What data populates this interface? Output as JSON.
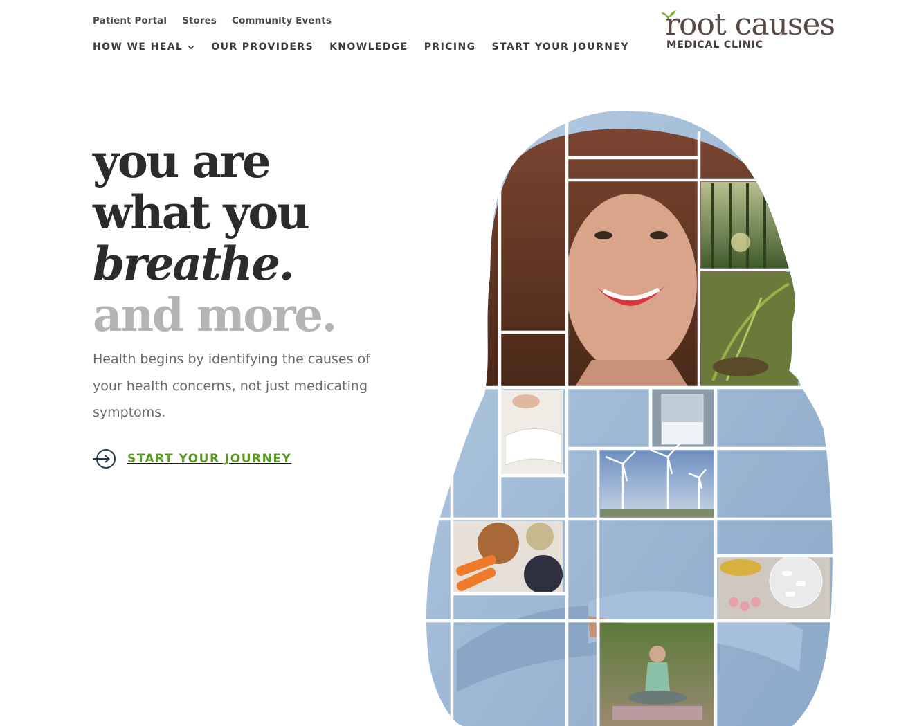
{
  "utility_nav": {
    "items": [
      "Patient Portal",
      "Stores",
      "Community Events"
    ]
  },
  "main_nav": {
    "items": [
      "HOW WE HEAL",
      "OUR PROVIDERS",
      "KNOWLEDGE",
      "PRICING",
      "START YOUR JOURNEY"
    ]
  },
  "logo": {
    "wordmark": "root causes",
    "subtitle": "MEDICAL CLINIC"
  },
  "hero": {
    "line1": "you are",
    "line2": "what you",
    "line3": "breathe.",
    "line4": "and more.",
    "intro": "Health begins by identifying the causes of your health concerns, not just medicating symptoms.",
    "cta_label": "START YOUR JOURNEY"
  },
  "colors": {
    "accent_green": "#5a9a1e",
    "heading": "#2b2b2b",
    "muted_heading": "#b4b4b4",
    "body_text": "#6e6865",
    "logo_brown": "#5a4b47"
  },
  "collage_tiles": [
    "forest",
    "plant-sprout",
    "book-hand",
    "glass-of-water",
    "wind-turbines",
    "nuts-and-berries",
    "supplements",
    "meditation-woman"
  ]
}
